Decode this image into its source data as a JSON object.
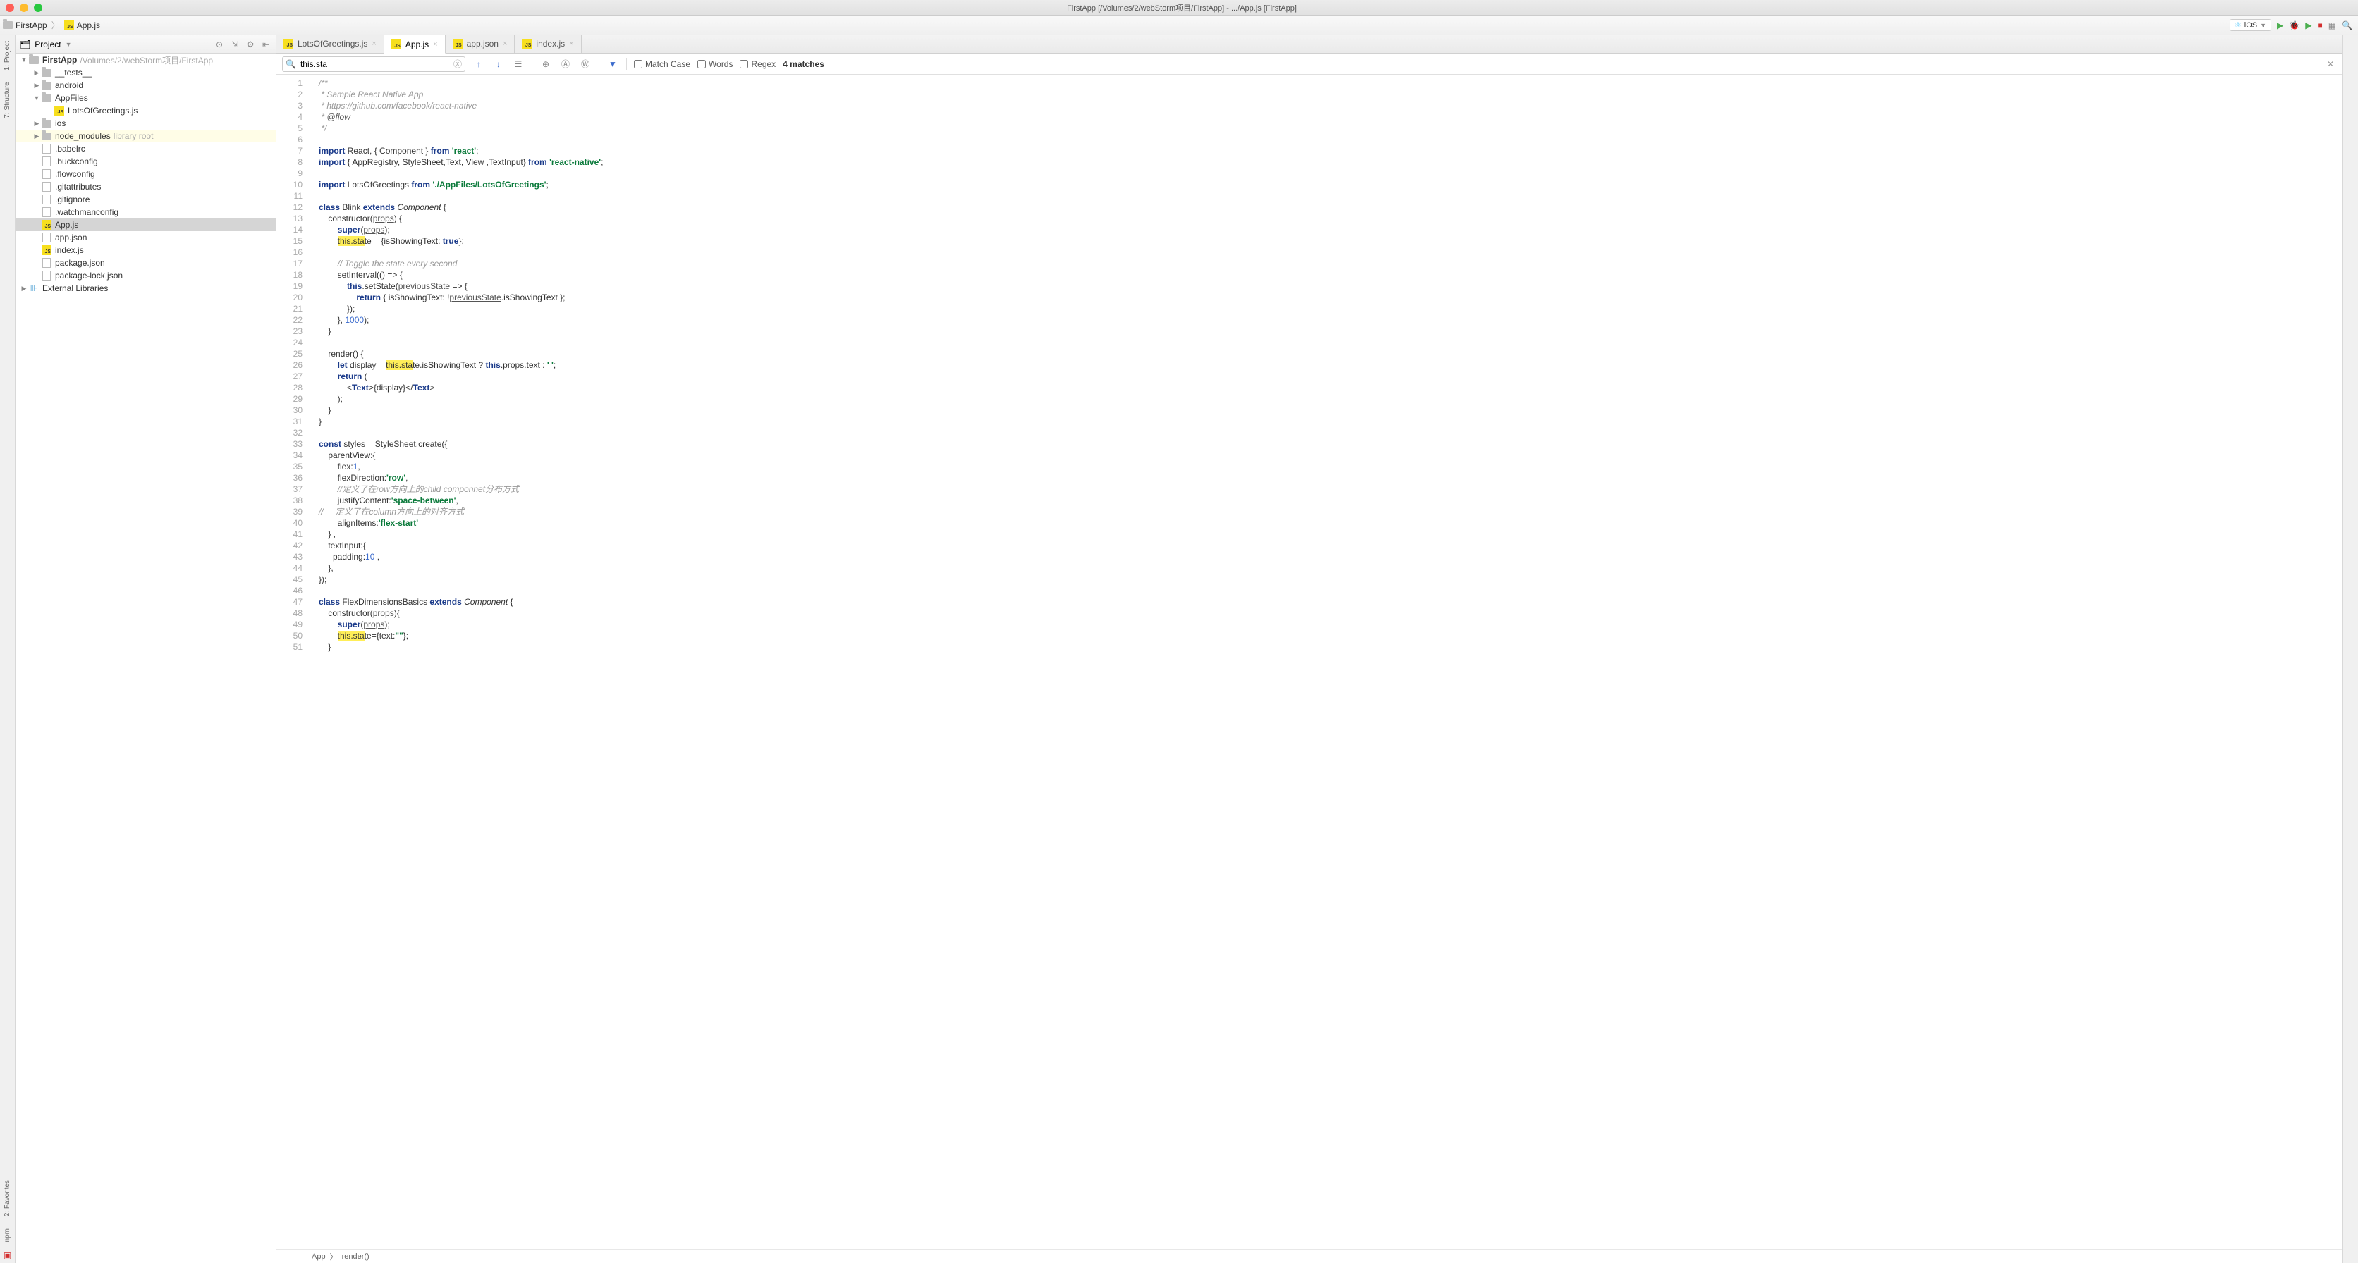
{
  "window": {
    "title": "FirstApp [/Volumes/2/webStorm项目/FirstApp] - .../App.js [FirstApp]"
  },
  "mac_dots": {
    "close": "#ff5f57",
    "min": "#febc2e",
    "max": "#28c840"
  },
  "nav_crumbs": {
    "root": "FirstApp",
    "file": "App.js"
  },
  "run_target": {
    "label": "iOS"
  },
  "left_tabs": {
    "project": "1: Project",
    "structure": "7: Structure",
    "favorites": "2: Favorites",
    "npm": "npm"
  },
  "project_panel": {
    "title": "Project",
    "root": {
      "name": "FirstApp",
      "path": "/Volumes/2/webStorm项目/FirstApp"
    },
    "items": [
      {
        "name": "__tests__",
        "type": "folder",
        "arrow": "▶",
        "indent": 1
      },
      {
        "name": "android",
        "type": "folder",
        "arrow": "▶",
        "indent": 1
      },
      {
        "name": "AppFiles",
        "type": "folder",
        "arrow": "▼",
        "indent": 1
      },
      {
        "name": "LotsOfGreetings.js",
        "type": "js",
        "arrow": "",
        "indent": 2
      },
      {
        "name": "ios",
        "type": "folder",
        "arrow": "▶",
        "indent": 1
      },
      {
        "name": "node_modules",
        "type": "folder",
        "arrow": "▶",
        "indent": 1,
        "note": "library root",
        "lib": true
      },
      {
        "name": ".babelrc",
        "type": "file",
        "arrow": "",
        "indent": 1
      },
      {
        "name": ".buckconfig",
        "type": "file",
        "arrow": "",
        "indent": 1
      },
      {
        "name": ".flowconfig",
        "type": "file",
        "arrow": "",
        "indent": 1
      },
      {
        "name": ".gitattributes",
        "type": "file",
        "arrow": "",
        "indent": 1
      },
      {
        "name": ".gitignore",
        "type": "file",
        "arrow": "",
        "indent": 1
      },
      {
        "name": ".watchmanconfig",
        "type": "file",
        "arrow": "",
        "indent": 1
      },
      {
        "name": "App.js",
        "type": "js",
        "arrow": "",
        "indent": 1,
        "selected": true
      },
      {
        "name": "app.json",
        "type": "file",
        "arrow": "",
        "indent": 1
      },
      {
        "name": "index.js",
        "type": "js",
        "arrow": "",
        "indent": 1
      },
      {
        "name": "package.json",
        "type": "file",
        "arrow": "",
        "indent": 1
      },
      {
        "name": "package-lock.json",
        "type": "file",
        "arrow": "",
        "indent": 1
      }
    ],
    "external": "External Libraries"
  },
  "tabs": [
    {
      "label": "LotsOfGreetings.js",
      "active": false
    },
    {
      "label": "App.js",
      "active": true
    },
    {
      "label": "app.json",
      "active": false
    },
    {
      "label": "index.js",
      "active": false
    }
  ],
  "find": {
    "query": "this.sta",
    "match_case": "Match Case",
    "words": "Words",
    "regex": "Regex",
    "matches": "4 matches"
  },
  "breadcrumb": {
    "a": "App",
    "b": "render()"
  },
  "code": {
    "lines": [
      {
        "n": 1,
        "h": "<span class='c-cmt'>/**</span>"
      },
      {
        "n": 2,
        "h": "<span class='c-cmt'> * Sample React Native App</span>"
      },
      {
        "n": 3,
        "h": "<span class='c-cmt'> * https://github.com/facebook/react-native</span>"
      },
      {
        "n": 4,
        "h": "<span class='c-cmt'> * <span class='c-udl'>@flow</span></span>"
      },
      {
        "n": 5,
        "h": "<span class='c-cmt'> */</span>"
      },
      {
        "n": 6,
        "h": ""
      },
      {
        "n": 7,
        "h": "<span class='c-kw'>import</span> React, { Component } <span class='c-kw'>from</span> <span class='c-str'>'react'</span>;"
      },
      {
        "n": 8,
        "h": "<span class='c-kw'>import</span> { AppRegistry, StyleSheet,Text, View ,TextInput} <span class='c-kw'>from</span> <span class='c-str'>'react-native'</span>;"
      },
      {
        "n": 9,
        "h": ""
      },
      {
        "n": 10,
        "h": "<span class='c-kw'>import</span> LotsOfGreetings <span class='c-kw'>from</span> <span class='c-str'>'./AppFiles/LotsOfGreetings'</span>;"
      },
      {
        "n": 11,
        "h": ""
      },
      {
        "n": 12,
        "h": "<span class='c-kw'>class</span> Blink <span class='c-kw'>extends</span> <span style='font-style:italic'>Component</span> {"
      },
      {
        "n": 13,
        "h": "    constructor(<span class='c-udl'>props</span>) {"
      },
      {
        "n": 14,
        "h": "        <span class='c-kw'>super</span>(<span class='c-udl'>props</span>);"
      },
      {
        "n": 15,
        "h": "        <span class='c-hl'>this.sta</span>te = {isShowingText: <span class='c-kw'>true</span>};"
      },
      {
        "n": 16,
        "h": ""
      },
      {
        "n": 17,
        "h": "        <span class='c-cmt'>// Toggle the state every second</span>"
      },
      {
        "n": 18,
        "h": "        setInterval(() =&gt; {"
      },
      {
        "n": 19,
        "h": "            <span class='c-kw'>this</span>.setState(<span class='c-udl'>previousState</span> =&gt; {"
      },
      {
        "n": 20,
        "h": "                <span class='c-kw'>return</span> { isShowingText: !<span class='c-udl'>previousState</span>.isShowingText };"
      },
      {
        "n": 21,
        "h": "            });"
      },
      {
        "n": 22,
        "h": "        }, <span class='c-num'>1000</span>);"
      },
      {
        "n": 23,
        "h": "    }"
      },
      {
        "n": 24,
        "h": ""
      },
      {
        "n": 25,
        "h": "    render() {"
      },
      {
        "n": 26,
        "h": "        <span class='c-kw'>let</span> display = <span class='c-hl'>this.sta</span>te.isShowingText ? <span class='c-kw'>this</span>.props.text : <span class='c-str'>' '</span>;"
      },
      {
        "n": 27,
        "h": "        <span class='c-kw'>return</span> ("
      },
      {
        "n": 28,
        "h": "            &lt;<span class='c-tag'>Text</span>&gt;{display}&lt;/<span class='c-tag'>Text</span>&gt;"
      },
      {
        "n": 29,
        "h": "        );"
      },
      {
        "n": 30,
        "h": "    }"
      },
      {
        "n": 31,
        "h": "}"
      },
      {
        "n": 32,
        "h": ""
      },
      {
        "n": 33,
        "h": "<span class='c-kw'>const</span> styles = StyleSheet.create({"
      },
      {
        "n": 34,
        "h": "    parentView:{"
      },
      {
        "n": 35,
        "h": "        flex:<span class='c-num'>1</span>,"
      },
      {
        "n": 36,
        "h": "        flexDirection:<span class='c-str'>'row'</span>,"
      },
      {
        "n": 37,
        "h": "        <span class='c-cmt'>//定义了在row方向上的child componnet分布方式</span>"
      },
      {
        "n": 38,
        "h": "        justifyContent:<span class='c-str'>'space-between'</span>,"
      },
      {
        "n": 39,
        "h": "<span class='c-cmt'>//     定义了在column方向上的对齐方式</span>"
      },
      {
        "n": 40,
        "h": "        alignItems:<span class='c-str'>'flex-start'</span>"
      },
      {
        "n": 41,
        "h": "    } ,"
      },
      {
        "n": 42,
        "h": "    textInput:{"
      },
      {
        "n": 43,
        "h": "      padding:<span class='c-num'>10</span> ,"
      },
      {
        "n": 44,
        "h": "    },"
      },
      {
        "n": 45,
        "h": "});"
      },
      {
        "n": 46,
        "h": ""
      },
      {
        "n": 47,
        "h": "<span class='c-kw'>class</span> FlexDimensionsBasics <span class='c-kw'>extends</span> <span style='font-style:italic'>Component</span> {"
      },
      {
        "n": 48,
        "h": "    constructor(<span class='c-udl'>props</span>){"
      },
      {
        "n": 49,
        "h": "        <span class='c-kw'>super</span>(<span class='c-udl'>props</span>);"
      },
      {
        "n": 50,
        "h": "        <span class='c-hl'>this.sta</span>te={text:<span class='c-str'>\"\"</span>};"
      },
      {
        "n": 51,
        "h": "    }"
      }
    ]
  }
}
